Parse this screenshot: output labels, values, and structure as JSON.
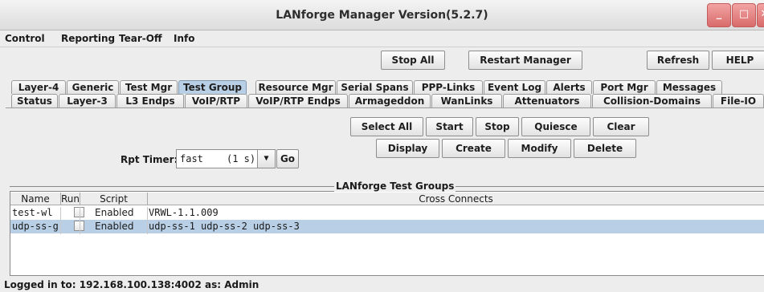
{
  "window": {
    "title": "LANforge Manager   Version(5.2.7)",
    "min_glyph": "_",
    "max_glyph": "□",
    "close_glyph": "✕"
  },
  "menu": [
    "Control",
    "Reporting",
    "Tear-Off",
    "Info"
  ],
  "toolbar": {
    "stop_all": "Stop All",
    "restart_manager": "Restart Manager",
    "refresh": "Refresh",
    "help": "HELP"
  },
  "tabs_row1": [
    "Layer-4",
    "Generic",
    "Test Mgr",
    "Test Group",
    "Resource Mgr",
    "Serial Spans",
    "PPP-Links",
    "Event Log",
    "Alerts",
    "Port Mgr",
    "Messages"
  ],
  "tabs_row2": [
    "Status",
    "Layer-3",
    "L3 Endps",
    "VoIP/RTP",
    "VoIP/RTP Endps",
    "Armageddon",
    "WanLinks",
    "Attenuators",
    "Collision-Domains",
    "File-IO"
  ],
  "selected_tab": "Test Group",
  "controls": {
    "rpt_timer_label": "Rpt Timer:",
    "rpt_timer_value": "fast",
    "rpt_timer_interval": "(1 s)",
    "go": "Go",
    "select_all": "Select All",
    "start": "Start",
    "stop": "Stop",
    "quiesce": "Quiesce",
    "clear": "Clear",
    "display": "Display",
    "create": "Create",
    "modify": "Modify",
    "delete": "Delete"
  },
  "group_title": "LANforge Test Groups",
  "table": {
    "columns": [
      "Name",
      "Run",
      "Script",
      "Cross Connects"
    ],
    "rows": [
      {
        "name": "test-wl",
        "run": false,
        "script": "Enabled",
        "cross_connects": "VRWL-1.1.009",
        "selected": false
      },
      {
        "name": "udp-ss-g",
        "run": false,
        "script": "Enabled",
        "cross_connects": "udp-ss-1 udp-ss-2 udp-ss-3",
        "selected": true
      }
    ]
  },
  "status": "Logged in to:  192.168.100.138:4002  as:  Admin",
  "colors": {
    "selection": "#b8cfe5",
    "window_bg": "#ededed",
    "close_button": "#d96b6b"
  }
}
